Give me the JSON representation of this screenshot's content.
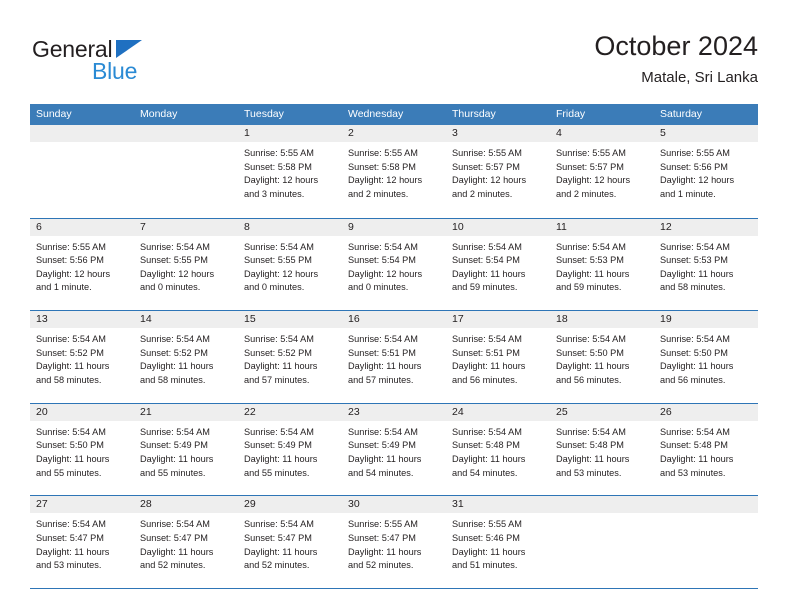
{
  "brand": {
    "name_top": "General",
    "name_bottom": "Blue",
    "triangle_color": "#1f70c1",
    "blue_text_color": "#2a8ad4"
  },
  "header": {
    "title": "October 2024",
    "subtitle": "Matale, Sri Lanka"
  },
  "theme": {
    "header_blue": "#3b7cb8",
    "rule_blue": "#2e75b6",
    "day_band_gray": "#eeeeee",
    "text_color": "#231f20"
  },
  "weekdays": [
    "Sunday",
    "Monday",
    "Tuesday",
    "Wednesday",
    "Thursday",
    "Friday",
    "Saturday"
  ],
  "weeks": [
    [
      {
        "day": "",
        "empty": true,
        "lines": []
      },
      {
        "day": "",
        "empty": true,
        "lines": []
      },
      {
        "day": "1",
        "lines": [
          "Sunrise: 5:55 AM",
          "Sunset: 5:58 PM",
          "Daylight: 12 hours",
          "and 3 minutes."
        ]
      },
      {
        "day": "2",
        "lines": [
          "Sunrise: 5:55 AM",
          "Sunset: 5:58 PM",
          "Daylight: 12 hours",
          "and 2 minutes."
        ]
      },
      {
        "day": "3",
        "lines": [
          "Sunrise: 5:55 AM",
          "Sunset: 5:57 PM",
          "Daylight: 12 hours",
          "and 2 minutes."
        ]
      },
      {
        "day": "4",
        "lines": [
          "Sunrise: 5:55 AM",
          "Sunset: 5:57 PM",
          "Daylight: 12 hours",
          "and 2 minutes."
        ]
      },
      {
        "day": "5",
        "lines": [
          "Sunrise: 5:55 AM",
          "Sunset: 5:56 PM",
          "Daylight: 12 hours",
          "and 1 minute."
        ]
      }
    ],
    [
      {
        "day": "6",
        "lines": [
          "Sunrise: 5:55 AM",
          "Sunset: 5:56 PM",
          "Daylight: 12 hours",
          "and 1 minute."
        ]
      },
      {
        "day": "7",
        "lines": [
          "Sunrise: 5:54 AM",
          "Sunset: 5:55 PM",
          "Daylight: 12 hours",
          "and 0 minutes."
        ]
      },
      {
        "day": "8",
        "lines": [
          "Sunrise: 5:54 AM",
          "Sunset: 5:55 PM",
          "Daylight: 12 hours",
          "and 0 minutes."
        ]
      },
      {
        "day": "9",
        "lines": [
          "Sunrise: 5:54 AM",
          "Sunset: 5:54 PM",
          "Daylight: 12 hours",
          "and 0 minutes."
        ]
      },
      {
        "day": "10",
        "lines": [
          "Sunrise: 5:54 AM",
          "Sunset: 5:54 PM",
          "Daylight: 11 hours",
          "and 59 minutes."
        ]
      },
      {
        "day": "11",
        "lines": [
          "Sunrise: 5:54 AM",
          "Sunset: 5:53 PM",
          "Daylight: 11 hours",
          "and 59 minutes."
        ]
      },
      {
        "day": "12",
        "lines": [
          "Sunrise: 5:54 AM",
          "Sunset: 5:53 PM",
          "Daylight: 11 hours",
          "and 58 minutes."
        ]
      }
    ],
    [
      {
        "day": "13",
        "lines": [
          "Sunrise: 5:54 AM",
          "Sunset: 5:52 PM",
          "Daylight: 11 hours",
          "and 58 minutes."
        ]
      },
      {
        "day": "14",
        "lines": [
          "Sunrise: 5:54 AM",
          "Sunset: 5:52 PM",
          "Daylight: 11 hours",
          "and 58 minutes."
        ]
      },
      {
        "day": "15",
        "lines": [
          "Sunrise: 5:54 AM",
          "Sunset: 5:52 PM",
          "Daylight: 11 hours",
          "and 57 minutes."
        ]
      },
      {
        "day": "16",
        "lines": [
          "Sunrise: 5:54 AM",
          "Sunset: 5:51 PM",
          "Daylight: 11 hours",
          "and 57 minutes."
        ]
      },
      {
        "day": "17",
        "lines": [
          "Sunrise: 5:54 AM",
          "Sunset: 5:51 PM",
          "Daylight: 11 hours",
          "and 56 minutes."
        ]
      },
      {
        "day": "18",
        "lines": [
          "Sunrise: 5:54 AM",
          "Sunset: 5:50 PM",
          "Daylight: 11 hours",
          "and 56 minutes."
        ]
      },
      {
        "day": "19",
        "lines": [
          "Sunrise: 5:54 AM",
          "Sunset: 5:50 PM",
          "Daylight: 11 hours",
          "and 56 minutes."
        ]
      }
    ],
    [
      {
        "day": "20",
        "lines": [
          "Sunrise: 5:54 AM",
          "Sunset: 5:50 PM",
          "Daylight: 11 hours",
          "and 55 minutes."
        ]
      },
      {
        "day": "21",
        "lines": [
          "Sunrise: 5:54 AM",
          "Sunset: 5:49 PM",
          "Daylight: 11 hours",
          "and 55 minutes."
        ]
      },
      {
        "day": "22",
        "lines": [
          "Sunrise: 5:54 AM",
          "Sunset: 5:49 PM",
          "Daylight: 11 hours",
          "and 55 minutes."
        ]
      },
      {
        "day": "23",
        "lines": [
          "Sunrise: 5:54 AM",
          "Sunset: 5:49 PM",
          "Daylight: 11 hours",
          "and 54 minutes."
        ]
      },
      {
        "day": "24",
        "lines": [
          "Sunrise: 5:54 AM",
          "Sunset: 5:48 PM",
          "Daylight: 11 hours",
          "and 54 minutes."
        ]
      },
      {
        "day": "25",
        "lines": [
          "Sunrise: 5:54 AM",
          "Sunset: 5:48 PM",
          "Daylight: 11 hours",
          "and 53 minutes."
        ]
      },
      {
        "day": "26",
        "lines": [
          "Sunrise: 5:54 AM",
          "Sunset: 5:48 PM",
          "Daylight: 11 hours",
          "and 53 minutes."
        ]
      }
    ],
    [
      {
        "day": "27",
        "lines": [
          "Sunrise: 5:54 AM",
          "Sunset: 5:47 PM",
          "Daylight: 11 hours",
          "and 53 minutes."
        ]
      },
      {
        "day": "28",
        "lines": [
          "Sunrise: 5:54 AM",
          "Sunset: 5:47 PM",
          "Daylight: 11 hours",
          "and 52 minutes."
        ]
      },
      {
        "day": "29",
        "lines": [
          "Sunrise: 5:54 AM",
          "Sunset: 5:47 PM",
          "Daylight: 11 hours",
          "and 52 minutes."
        ]
      },
      {
        "day": "30",
        "lines": [
          "Sunrise: 5:55 AM",
          "Sunset: 5:47 PM",
          "Daylight: 11 hours",
          "and 52 minutes."
        ]
      },
      {
        "day": "31",
        "lines": [
          "Sunrise: 5:55 AM",
          "Sunset: 5:46 PM",
          "Daylight: 11 hours",
          "and 51 minutes."
        ]
      },
      {
        "day": "",
        "empty": true,
        "lines": []
      },
      {
        "day": "",
        "empty": true,
        "lines": []
      }
    ]
  ]
}
